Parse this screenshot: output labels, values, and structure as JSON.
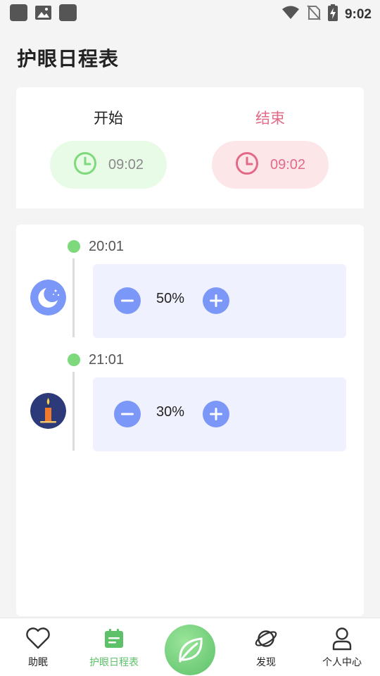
{
  "status_bar": {
    "time": "9:02"
  },
  "page": {
    "title": "护眼日程表"
  },
  "schedule": {
    "start_label": "开始",
    "start_time": "09:02",
    "end_label": "结束",
    "end_time": "09:02",
    "colors": {
      "start_accent": "#7dd97c",
      "end_accent": "#e36a87"
    }
  },
  "timeline": {
    "entries": [
      {
        "time": "20:01",
        "icon": "moon-icon",
        "value": "50%"
      },
      {
        "time": "21:01",
        "icon": "candle-icon",
        "value": "30%"
      }
    ]
  },
  "bottom_nav": {
    "items": [
      {
        "label": "助眠",
        "icon": "heart-icon"
      },
      {
        "label": "护眼日程表",
        "icon": "schedule-icon",
        "active": true
      },
      {
        "label": "",
        "icon": "leaf-icon"
      },
      {
        "label": "发现",
        "icon": "planet-icon"
      },
      {
        "label": "个人中心",
        "icon": "person-icon"
      }
    ],
    "active_color": "#5cc168"
  }
}
